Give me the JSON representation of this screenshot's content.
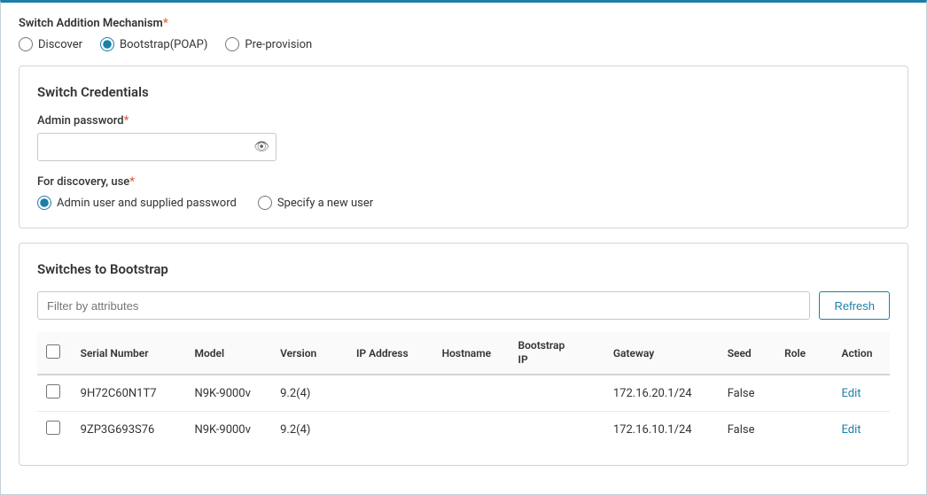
{
  "mechanism": {
    "label": "Switch Addition Mechanism",
    "options": [
      {
        "id": "discover",
        "label": "Discover",
        "checked": false
      },
      {
        "id": "bootstrap",
        "label": "Bootstrap(POAP)",
        "checked": true
      },
      {
        "id": "preprovision",
        "label": "Pre-provision",
        "checked": false
      }
    ]
  },
  "credentials": {
    "title": "Switch Credentials",
    "password_label": "Admin password",
    "password_placeholder": "",
    "discovery_label": "For discovery, use",
    "discovery_options": [
      {
        "id": "admin-user",
        "label": "Admin user and supplied password",
        "checked": true
      },
      {
        "id": "specify-user",
        "label": "Specify a new user",
        "checked": false
      }
    ]
  },
  "bootstrap": {
    "title": "Switches to Bootstrap",
    "filter_placeholder": "Filter by attributes",
    "refresh_label": "Refresh",
    "columns": [
      {
        "key": "checkbox",
        "label": ""
      },
      {
        "key": "serial",
        "label": "Serial Number"
      },
      {
        "key": "model",
        "label": "Model"
      },
      {
        "key": "version",
        "label": "Version"
      },
      {
        "key": "ip",
        "label": "IP Address"
      },
      {
        "key": "hostname",
        "label": "Hostname"
      },
      {
        "key": "bootstrap_ip",
        "label": "Bootstrap IP"
      },
      {
        "key": "gateway",
        "label": "Gateway"
      },
      {
        "key": "seed",
        "label": "Seed"
      },
      {
        "key": "role",
        "label": "Role"
      },
      {
        "key": "action",
        "label": "Action"
      }
    ],
    "rows": [
      {
        "serial": "9H72C60N1T7",
        "model": "N9K-9000v",
        "version": "9.2(4)",
        "ip": "",
        "hostname": "",
        "bootstrap_ip": "",
        "gateway": "172.16.20.1/24",
        "seed": "False",
        "role": "",
        "action": "Edit"
      },
      {
        "serial": "9ZP3G693S76",
        "model": "N9K-9000v",
        "version": "9.2(4)",
        "ip": "",
        "hostname": "",
        "bootstrap_ip": "",
        "gateway": "172.16.10.1/24",
        "seed": "False",
        "role": "",
        "action": "Edit"
      }
    ]
  }
}
